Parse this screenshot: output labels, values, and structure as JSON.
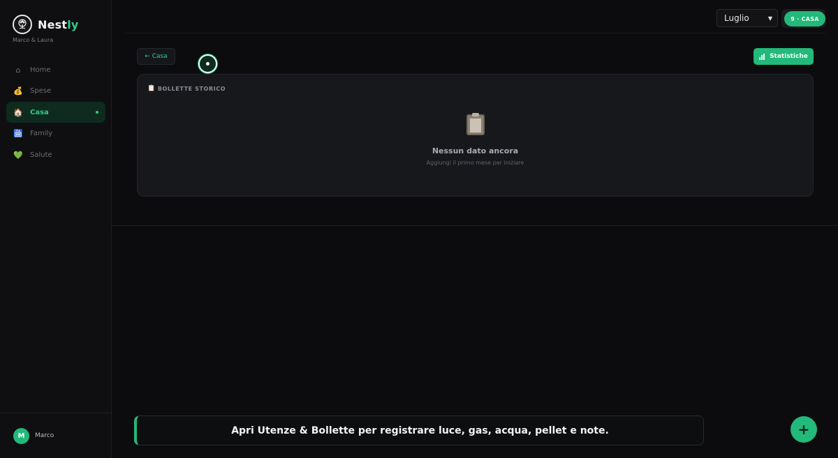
{
  "brand": {
    "name_main": "Nest",
    "name_accent": "ly",
    "household": "Marco & Laura",
    "logo_icon": "tree-icon"
  },
  "nav": {
    "items": [
      {
        "label": "Home",
        "icon": "⌂",
        "icon_name": "home-icon",
        "active": false
      },
      {
        "label": "Spese",
        "icon": "💰",
        "icon_name": "money-bag-icon",
        "active": false
      },
      {
        "label": "Casa",
        "icon": "🏠",
        "icon_name": "house-icon",
        "active": true
      },
      {
        "label": "Family",
        "icon": "🛗",
        "icon_name": "family-icon",
        "active": false
      },
      {
        "label": "Salute",
        "icon": "💚",
        "icon_name": "green-heart-icon",
        "active": false
      }
    ]
  },
  "user": {
    "initial": "M",
    "name": "Marco"
  },
  "topbar": {
    "month_selected": "Luglio",
    "section_chip": "9 · CASA"
  },
  "actions": {
    "back_label": "← Casa",
    "stats_label": "Statistiche",
    "stats_icon": "bar-chart-icon"
  },
  "card": {
    "title_emoji": "📋",
    "title": "BOLLETTE STORICO",
    "empty_icon": "clipboard-icon",
    "empty_title": "Nessun dato ancora",
    "empty_subtitle": "Aggiungi il primo mese per iniziare"
  },
  "hint": {
    "text": "Apri Utenze & Bollette per registrare luce, gas, acqua, pellet e note."
  },
  "fab": {
    "label": "+"
  },
  "colors": {
    "accent": "#22b97a",
    "accent_text": "#2fce8d",
    "background": "#0c0c0e"
  }
}
